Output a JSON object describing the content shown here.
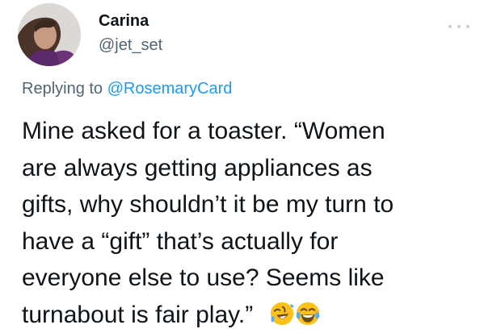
{
  "author": {
    "display_name": "Carina",
    "handle": "@jet_set"
  },
  "reply": {
    "prefix": "Replying to ",
    "mention": "@RosemaryCard"
  },
  "tweet": {
    "lines": [
      "Mine asked for a toaster. “Women",
      "are always getting appliances as",
      "gifts, why shouldn’t it be my turn to",
      "have a “gift” that’s actually for",
      "everyone else to use? Seems like",
      "turnabout is fair play.”"
    ],
    "emojis": [
      "rolling-on-floor-laughing-emoji",
      "tears-of-joy-emoji"
    ]
  },
  "icons": {
    "more": "more-options-icon",
    "avatar": "profile-photo"
  },
  "colors": {
    "text": "#0f1419",
    "secondary": "#536471",
    "link": "#1d9bf0",
    "emoji_yellow": "#fcc21b"
  }
}
